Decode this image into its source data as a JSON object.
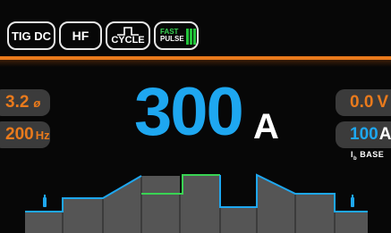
{
  "top_bar": {
    "tig_label": "TIG DC",
    "hf_label": "HF",
    "cycle_label": "CYCLE",
    "fast_label": "FAST",
    "pulse_label": "PULSE"
  },
  "left": {
    "electrode_value": "3.2",
    "electrode_symbol": "ø",
    "frequency_value": "200",
    "frequency_unit": "Hz"
  },
  "right": {
    "voltage_value": "0.0",
    "voltage_unit": "V",
    "base_value": "100",
    "base_unit": "A",
    "base_label_prefix": "I",
    "base_label_sub": "b",
    "base_label": "BASE"
  },
  "main": {
    "current_value": "300",
    "current_unit": "A"
  },
  "colors": {
    "accent_orange": "#e97a1c",
    "accent_blue": "#1ea7f0",
    "active_green": "#39d353",
    "background": "#070707"
  }
}
